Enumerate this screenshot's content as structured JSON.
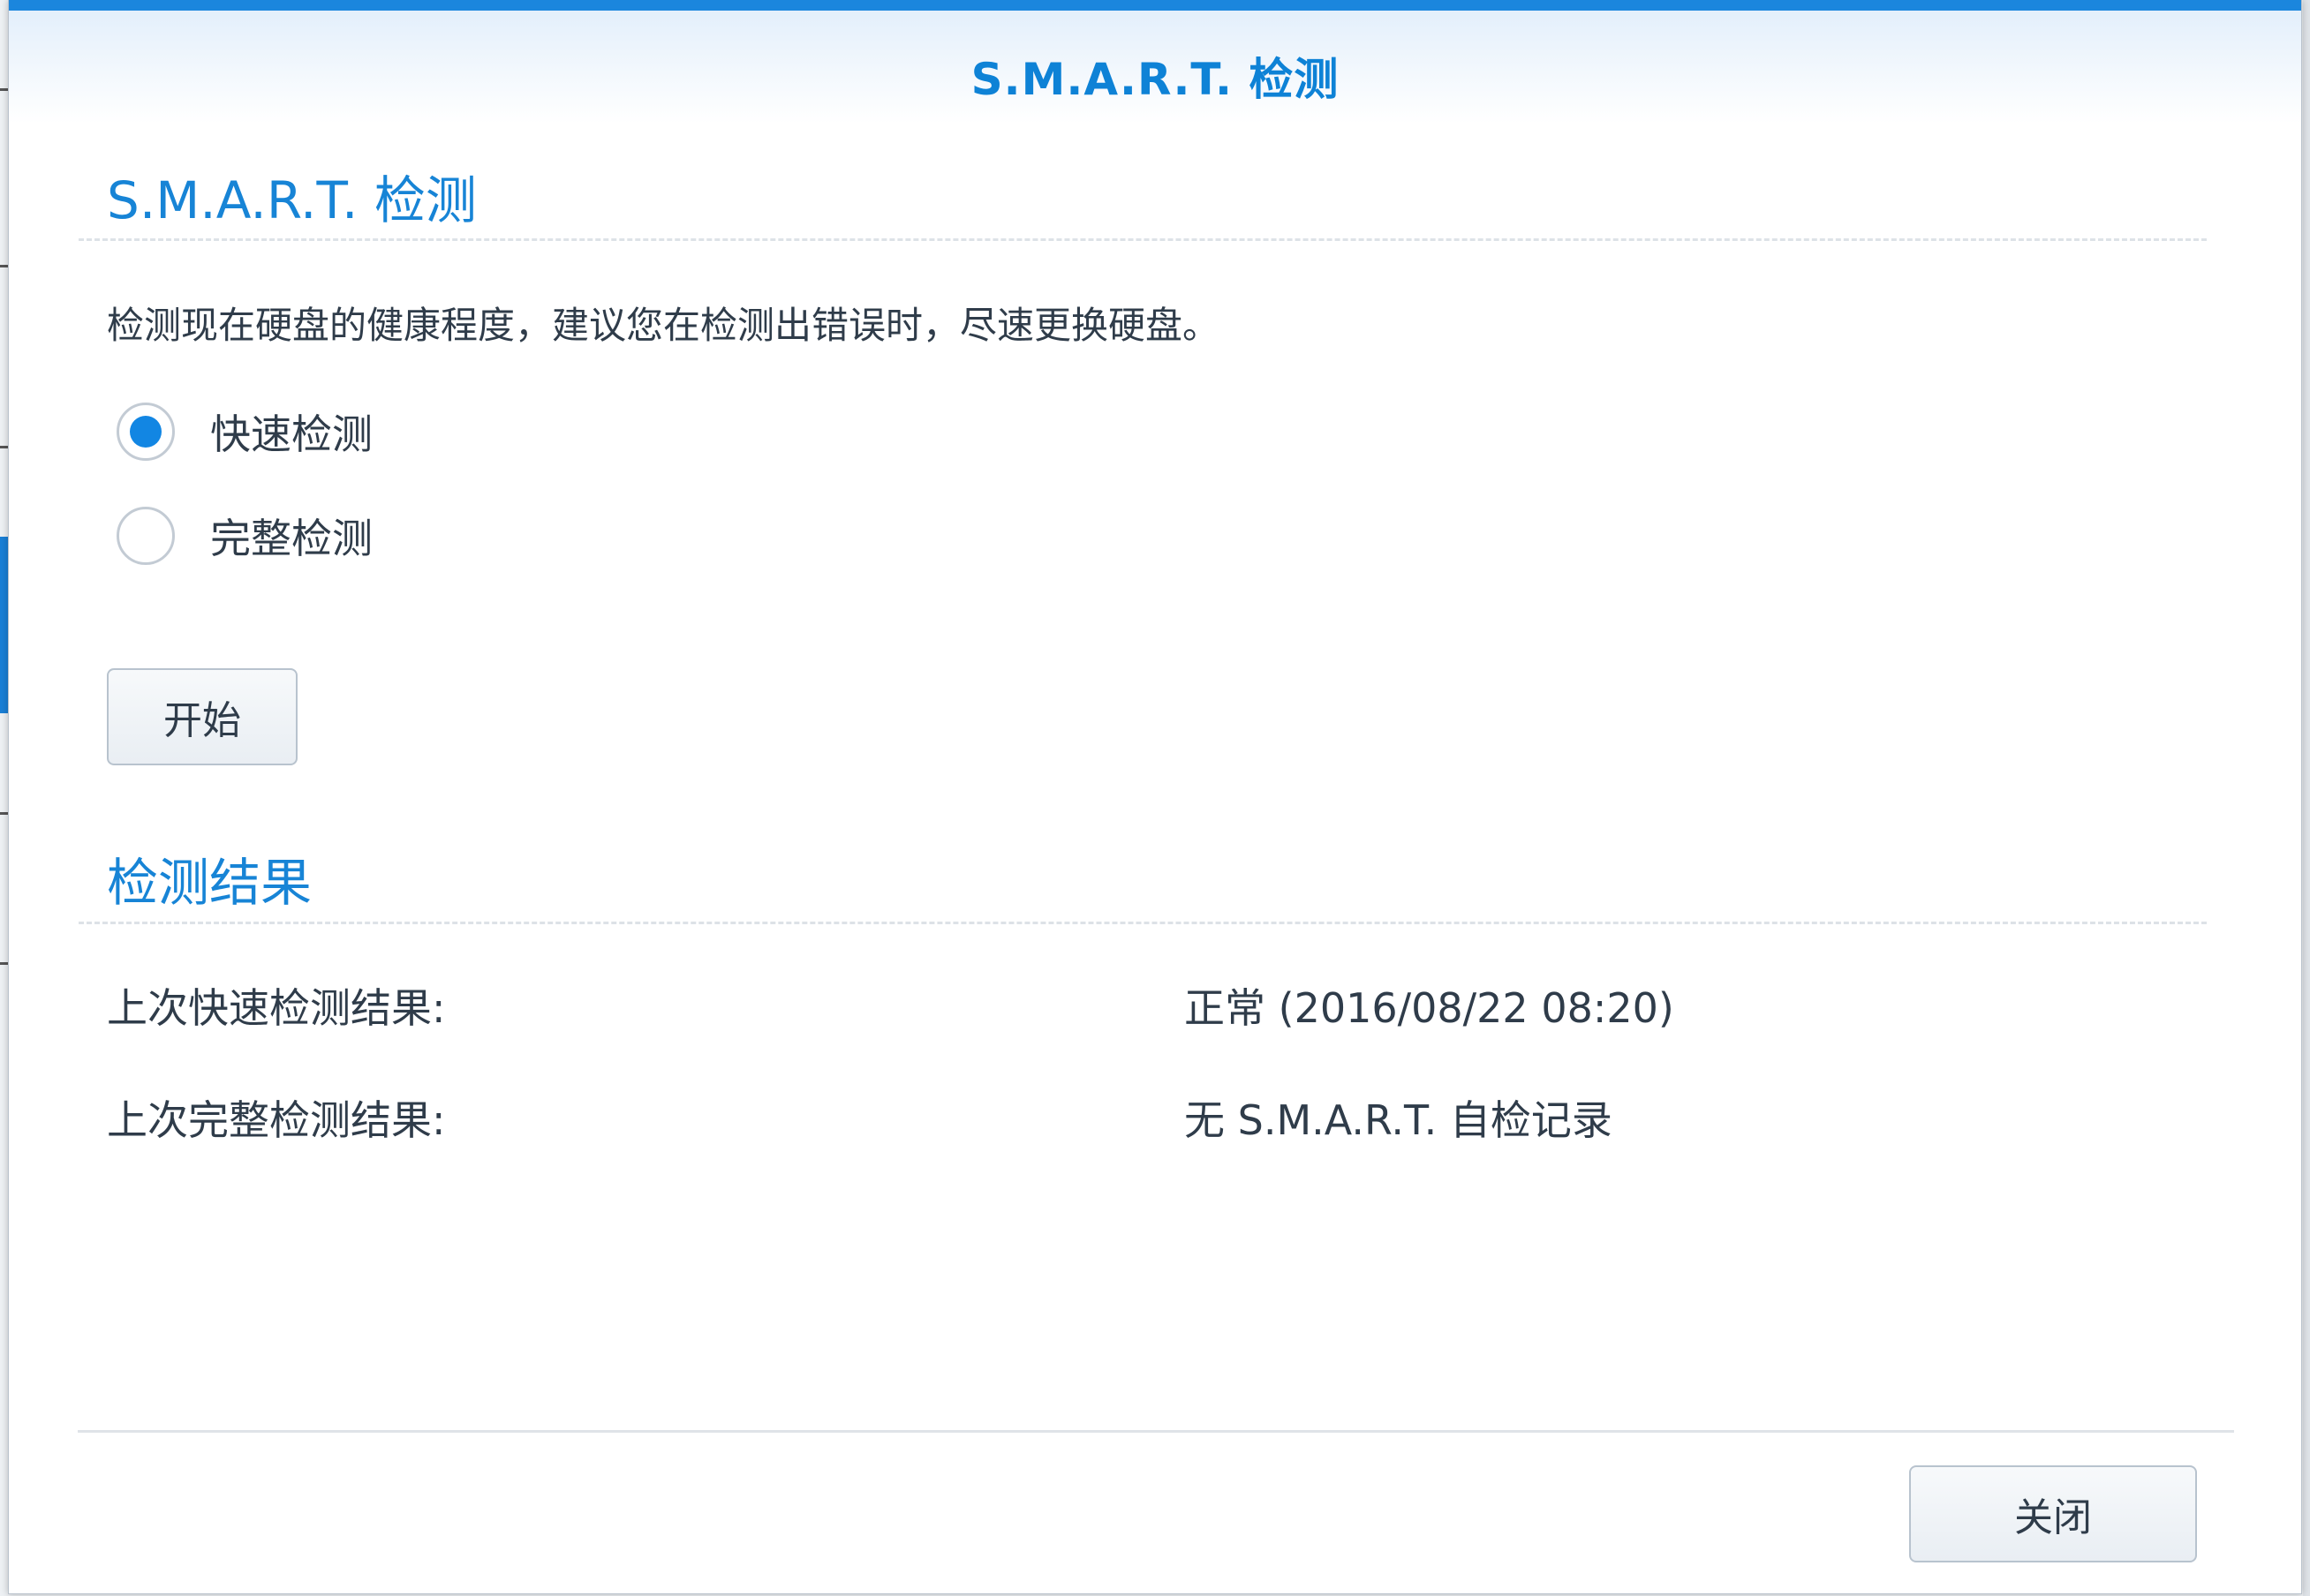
{
  "dialog": {
    "title": "S.M.A.R.T. 检测",
    "accent_color": "#1b86dd"
  },
  "smart_section": {
    "title": "S.M.A.R.T. 检测",
    "description": "检测现在硬盘的健康程度，建议您在检测出错误时，尽速更换硬盘。",
    "options": [
      {
        "label": "快速检测",
        "selected": true
      },
      {
        "label": "完整检测",
        "selected": false
      }
    ],
    "start_label": "开始"
  },
  "results_section": {
    "title": "检测结果",
    "rows": [
      {
        "label": "上次快速检测结果:",
        "value": "正常 (2016/08/22 08:20)"
      },
      {
        "label": "上次完整检测结果:",
        "value": "无 S.M.A.R.T. 自检记录"
      }
    ]
  },
  "footer": {
    "close_label": "关闭"
  }
}
